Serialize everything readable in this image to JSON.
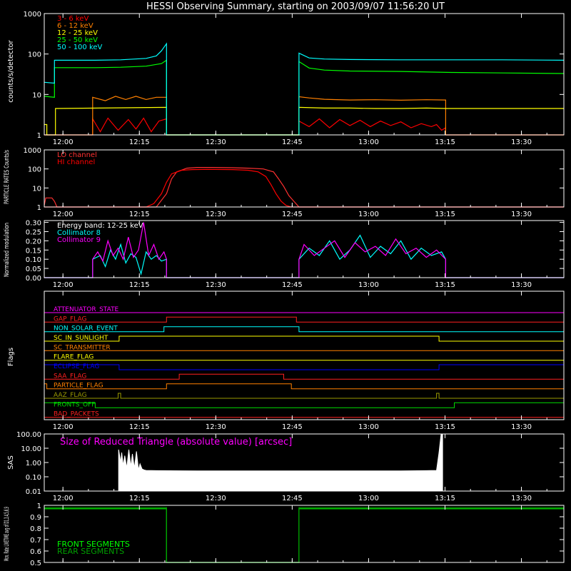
{
  "title": "HESSI Observing Summary, starting on 2003/09/07 11:56:20 UT",
  "time_axis": {
    "unit": "minutes after 11:56:20 UT",
    "range": [
      0,
      102
    ],
    "tick_values": [
      3.67,
      18.67,
      33.67,
      48.67,
      63.67,
      78.67,
      93.67
    ],
    "tick_labels": [
      "12:00",
      "12:15",
      "12:30",
      "12:45",
      "13:00",
      "13:15",
      "13:30"
    ]
  },
  "colors": {
    "background": "#000000",
    "axes": "#ffffff",
    "red": "#ff0000",
    "orange": "#ff8000",
    "yellow": "#ffff00",
    "green": "#00ff00",
    "cyan": "#00ffff",
    "magenta": "#ff00ff",
    "blue": "#0000ff",
    "olive": "#9a9a00",
    "dkgreen": "#00a000",
    "white": "#ffffff"
  },
  "chart_data": [
    {
      "id": "countrates",
      "type": "line",
      "ylabel": "counts/s/detector",
      "yscale": "log",
      "ylim": [
        1,
        1000
      ],
      "ytick_values": [
        1,
        10,
        100,
        1000
      ],
      "ytick_labels": [
        "1",
        "10",
        "100",
        "1000"
      ],
      "legend_position": "top-left",
      "series": [
        {
          "name": "3 - 6 keV",
          "color": "#ff0000",
          "x": [
            0,
            0.2,
            0.2,
            2.2,
            2.2,
            9.5,
            9.5,
            11,
            12.5,
            14.5,
            16.5,
            18,
            19.5,
            21,
            22.5,
            24,
            24,
            50,
            50,
            52,
            54,
            56,
            58,
            60,
            62,
            64,
            66,
            68,
            70,
            72,
            74,
            76,
            77,
            78,
            78.8,
            78.8,
            102
          ],
          "y": [
            1,
            1,
            1,
            1,
            1,
            1,
            2.5,
            1.2,
            2.6,
            1.3,
            2.4,
            1.4,
            2.6,
            1.2,
            2.2,
            2.5,
            1,
            1,
            2.2,
            1.6,
            2.5,
            1.5,
            2.4,
            1.7,
            2.3,
            1.6,
            2.2,
            1.7,
            2.1,
            1.5,
            1.9,
            1.6,
            1.8,
            1.3,
            1.5,
            1,
            1
          ]
        },
        {
          "name": "6 - 12 keV",
          "color": "#ff8000",
          "x": [
            0,
            2,
            2,
            9.5,
            9.5,
            12,
            14,
            16,
            18,
            20,
            22,
            24,
            24,
            50,
            50,
            52,
            55,
            60,
            65,
            70,
            75,
            78.8,
            78.8,
            102
          ],
          "y": [
            1,
            1,
            1,
            1,
            8.5,
            7,
            9,
            7.5,
            9,
            7.5,
            8.5,
            8.5,
            1,
            1,
            8.8,
            8.2,
            7.6,
            7.3,
            7.4,
            7.2,
            7.4,
            7.3,
            1,
            1
          ]
        },
        {
          "name": "12 - 25 keV",
          "color": "#ffff00",
          "x": [
            0,
            0.5,
            0.5,
            2.2,
            2.2,
            24,
            24,
            50,
            50,
            55,
            60,
            65,
            70,
            75,
            78.8,
            78.8,
            85,
            95,
            102
          ],
          "y": [
            1.8,
            1.8,
            1,
            1,
            4.5,
            4.8,
            1,
            1,
            4.8,
            4.6,
            4.6,
            4.5,
            4.5,
            4.6,
            4.5,
            4.5,
            4.5,
            4.5,
            4.5
          ]
        },
        {
          "name": "25 - 50 keV",
          "color": "#00ff00",
          "x": [
            0,
            2,
            2,
            5,
            10,
            15,
            20,
            23,
            24,
            24,
            50,
            50,
            52,
            55,
            60,
            70,
            80,
            90,
            102
          ],
          "y": [
            9,
            8.5,
            46,
            46,
            46,
            47,
            50,
            58,
            70,
            1,
            1,
            65,
            45,
            40,
            38,
            37,
            35,
            34,
            33
          ]
        },
        {
          "name": "50 - 100 keV",
          "color": "#00ffff",
          "x": [
            0,
            2,
            2,
            5,
            10,
            15,
            20,
            22,
            23,
            24,
            24,
            50,
            50,
            52,
            55,
            60,
            70,
            80,
            90,
            102
          ],
          "y": [
            20,
            19,
            70,
            70,
            70,
            72,
            78,
            90,
            120,
            180,
            1,
            1,
            105,
            80,
            75,
            73,
            72,
            72,
            72,
            70
          ]
        }
      ]
    },
    {
      "id": "particles",
      "type": "line",
      "ylabel": "PARTICLE RATES Counts/s",
      "yscale": "log",
      "ylim": [
        1,
        1000
      ],
      "ytick_values": [
        1,
        10,
        100,
        1000
      ],
      "ytick_labels": [
        "1",
        "10",
        "100",
        "1000"
      ],
      "legend_position": "top-left",
      "series": [
        {
          "name": "LO channel",
          "color": "#ff3030",
          "x": [
            0,
            0.3,
            0.5,
            1.5,
            2,
            2.5,
            5,
            20,
            22,
            24,
            25,
            26,
            28,
            30,
            33,
            37,
            40,
            43,
            45,
            46,
            47,
            48,
            49,
            50,
            52,
            102
          ],
          "y": [
            1.2,
            3,
            3,
            3,
            2,
            1,
            1,
            1,
            1,
            5,
            30,
            70,
            110,
            120,
            120,
            115,
            110,
            100,
            70,
            30,
            12,
            4,
            2,
            1,
            1,
            1
          ]
        },
        {
          "name": "HI channel",
          "color": "#ff0000",
          "x": [
            0,
            20,
            21.5,
            23,
            24,
            25,
            27,
            29,
            32,
            37,
            40,
            42,
            43.5,
            44.5,
            45.5,
            46.5,
            47.5,
            48.5,
            102
          ],
          "y": [
            1,
            1,
            1.5,
            5,
            20,
            55,
            85,
            92,
            95,
            92,
            85,
            70,
            40,
            15,
            5,
            2,
            1.2,
            1,
            1
          ]
        }
      ]
    },
    {
      "id": "modulation",
      "type": "line",
      "ylabel": "Normalized modulation",
      "ylim": [
        0,
        0.31
      ],
      "ytick_values": [
        0,
        0.05,
        0.1,
        0.15,
        0.2,
        0.25,
        0.3
      ],
      "ytick_labels": [
        "0.00",
        "0.05",
        "0.10",
        "0.15",
        "0.20",
        "0.25",
        "0.30"
      ],
      "annotation": "Energy band: 12-25 keV",
      "legend_position": "top-left",
      "series": [
        {
          "name": "Collimator 8",
          "color": "#00ffff",
          "x": [
            0,
            9.5,
            9.5,
            11,
            12,
            13,
            14,
            15,
            16,
            17,
            18,
            19,
            20,
            21,
            22,
            23,
            24,
            24,
            50,
            50,
            52,
            54,
            56,
            58,
            60,
            62,
            64,
            66,
            68,
            70,
            72,
            74,
            76,
            78,
            78.8,
            78.8,
            102
          ],
          "y": [
            0,
            0,
            0.1,
            0.12,
            0.06,
            0.15,
            0.1,
            0.18,
            0.08,
            0.13,
            0.11,
            0.02,
            0.14,
            0.1,
            0.12,
            0.09,
            0.1,
            0,
            0,
            0.1,
            0.16,
            0.12,
            0.2,
            0.1,
            0.15,
            0.23,
            0.11,
            0.17,
            0.13,
            0.2,
            0.1,
            0.16,
            0.12,
            0.14,
            0.1,
            0,
            0
          ]
        },
        {
          "name": "Collimator 9",
          "color": "#ff00ff",
          "x": [
            0,
            9.5,
            9.5,
            10.5,
            11.5,
            12.5,
            13.5,
            14.5,
            15.5,
            16.5,
            17.5,
            18.5,
            19.5,
            20.5,
            21.5,
            22.5,
            23.5,
            24,
            24,
            50,
            50,
            51,
            53,
            55,
            57,
            59,
            61,
            63,
            65,
            67,
            69,
            71,
            73,
            75,
            77,
            78.8,
            78.8,
            102
          ],
          "y": [
            0,
            0,
            0.1,
            0.14,
            0.09,
            0.2,
            0.12,
            0.16,
            0.1,
            0.22,
            0.11,
            0.15,
            0.3,
            0.12,
            0.18,
            0.1,
            0.14,
            0.1,
            0,
            0,
            0.1,
            0.18,
            0.12,
            0.16,
            0.2,
            0.11,
            0.19,
            0.14,
            0.17,
            0.12,
            0.21,
            0.13,
            0.16,
            0.11,
            0.15,
            0.1,
            0,
            0
          ]
        }
      ]
    },
    {
      "id": "flags",
      "type": "line",
      "ylabel": "Flags",
      "series": [
        {
          "name": "ATTENUATOR_STATE",
          "color": "#ff00ff",
          "x": [
            0,
            102
          ],
          "y": [
            0,
            0
          ]
        },
        {
          "name": "GAP_FLAG",
          "color": "#ff2020",
          "x": [
            0,
            24,
            24,
            49.5,
            49.5,
            102
          ],
          "y": [
            0,
            0,
            1,
            1,
            0,
            0
          ]
        },
        {
          "name": "NON_SOLAR_EVENT",
          "color": "#00ffff",
          "x": [
            0,
            23.5,
            23.5,
            50,
            50,
            102
          ],
          "y": [
            0,
            0,
            1,
            1,
            0,
            0
          ]
        },
        {
          "name": "SC_IN_SUNLIGHT",
          "color": "#ffff00",
          "x": [
            0,
            14.7,
            14.7,
            77.5,
            77.5,
            102
          ],
          "y": [
            0,
            0,
            1,
            1,
            0,
            0
          ]
        },
        {
          "name": "SC_TRANSMITTER",
          "color": "#ff8000",
          "x": [
            0,
            102
          ],
          "y": [
            0,
            0
          ]
        },
        {
          "name": "FLARE_FLAG",
          "color": "#ffff00",
          "x": [
            0,
            102
          ],
          "y": [
            0,
            0
          ]
        },
        {
          "name": "ECLIPSE_FLAG",
          "color": "#0000ff",
          "x": [
            0,
            14.7,
            14.7,
            77.5,
            77.5,
            102
          ],
          "y": [
            1,
            1,
            0,
            0,
            1,
            1
          ]
        },
        {
          "name": "SAA_FLAG",
          "color": "#ff2020",
          "x": [
            0,
            26.5,
            26.5,
            47,
            47,
            102
          ],
          "y": [
            0,
            0,
            1,
            1,
            0,
            0
          ]
        },
        {
          "name": "PARTICLE_FLAG",
          "color": "#ff8000",
          "x": [
            0,
            0.5,
            0.5,
            1.2,
            1.2,
            24,
            24,
            48.5,
            48.5,
            102
          ],
          "y": [
            1,
            1,
            0,
            0,
            0,
            0,
            1,
            1,
            0,
            0
          ]
        },
        {
          "name": "AAZ_FLAG",
          "color": "#9a9a00",
          "x": [
            0,
            14.5,
            14.5,
            15,
            15,
            77,
            77,
            77.5,
            77.5,
            102
          ],
          "y": [
            0,
            0,
            1,
            1,
            0,
            0,
            1,
            1,
            0,
            0
          ]
        },
        {
          "name": "FRONTS_OFF",
          "color": "#00dd00",
          "x": [
            0,
            10,
            10,
            80.5,
            80.5,
            102
          ],
          "y": [
            1,
            1,
            0,
            0,
            1,
            1
          ]
        },
        {
          "name": "BAD_PACKETS",
          "color": "#ff2020",
          "x": [
            0,
            102
          ],
          "y": [
            0,
            0
          ]
        }
      ]
    },
    {
      "id": "sas",
      "type": "area",
      "ylabel": "SAS",
      "yscale": "log",
      "ylim": [
        0.01,
        100
      ],
      "ytick_values": [
        0.01,
        0.1,
        1,
        10,
        100
      ],
      "ytick_labels": [
        "0.01",
        "0.10",
        "1.00",
        "10.00",
        "100.00"
      ],
      "annotation": "Size of Reduced Triangle (absolute value) [arcsec]",
      "series": [
        {
          "name": "Size of Reduced Triangle",
          "color": "#ffffff",
          "x": [
            14.6,
            14.6,
            15,
            15.2,
            15.5,
            15.8,
            16.2,
            16.6,
            17,
            17.3,
            17.7,
            18.1,
            18.5,
            18.8,
            19.2,
            19.6,
            20,
            22,
            30,
            40,
            50,
            60,
            70,
            75,
            77,
            77.5,
            77.9,
            78.2,
            78.2
          ],
          "y": [
            0.01,
            8,
            1,
            5,
            0.6,
            3,
            0.4,
            8,
            0.5,
            4,
            0.4,
            6,
            0.3,
            0.8,
            0.35,
            0.3,
            0.28,
            0.27,
            0.26,
            0.26,
            0.26,
            0.26,
            0.26,
            0.27,
            0.28,
            5,
            100,
            100,
            0.01
          ]
        }
      ]
    },
    {
      "id": "livetime",
      "type": "line",
      "ylabel": "Mon. Rate LIVETIME avg of D1,3,4,5,6,9",
      "ylim": [
        0.5,
        1
      ],
      "ytick_values": [
        0.5,
        0.6,
        0.7,
        0.8,
        0.9,
        1.0
      ],
      "ytick_labels": [
        "0.5",
        "0.6",
        "0.7",
        "0.8",
        "0.9",
        "1"
      ],
      "legend_position": "bottom-left",
      "series": [
        {
          "name": "FRONT SEGMENTS",
          "color": "#00ff00",
          "x": [
            0,
            24,
            24,
            50,
            50,
            102
          ],
          "y": [
            0.97,
            0.97,
            0.5,
            0.5,
            0.97,
            0.97
          ]
        },
        {
          "name": "REAR SEGMENTS",
          "color": "#00a000",
          "x": [
            0,
            24,
            24,
            50,
            50,
            102
          ],
          "y": [
            0.98,
            0.98,
            0.5,
            0.5,
            0.98,
            0.98
          ]
        }
      ]
    }
  ]
}
